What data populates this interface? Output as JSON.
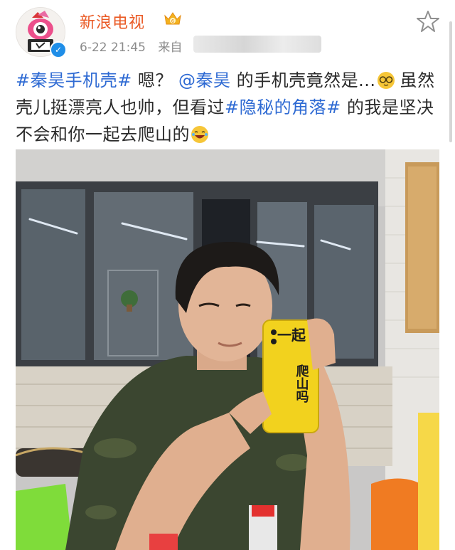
{
  "post": {
    "author": "新浪电视",
    "time": "6-22 21:45",
    "source_prefix": "来自",
    "text": {
      "topic1": "#秦昊手机壳#",
      "part1": " 嗯？",
      "mention": "@秦昊",
      "part2": " 的手机壳竟然是...",
      "part3": " 虽然壳儿挺漂亮人也帅，但看过",
      "topic2": "#隐秘的角落#",
      "part4": " 的我是坚决不会和你一起去爬山的"
    }
  },
  "photo": {
    "phone_case_text_top": "一起",
    "phone_case_text_side": "爬山吗",
    "colors": {
      "case": "#f2d21e",
      "wall": "#c7c6c6",
      "shirt": "#3a4a2c"
    }
  },
  "colors": {
    "author": "#ea5a25",
    "topic": "#2e6ad3",
    "meta": "#8b8b8b",
    "verified": "#1f8ee8"
  }
}
